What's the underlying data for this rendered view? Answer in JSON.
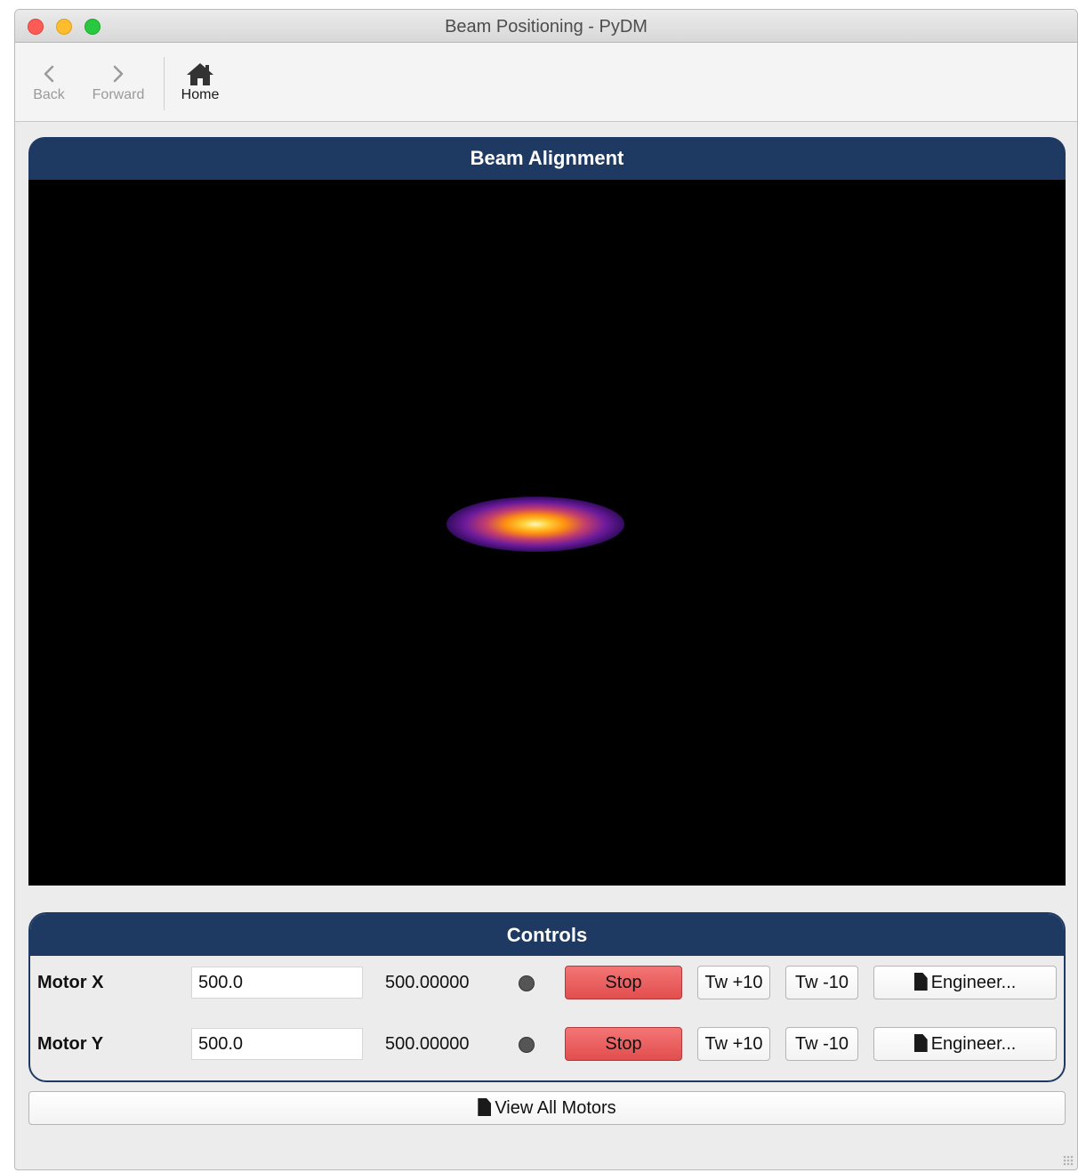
{
  "window": {
    "title": "Beam Positioning - PyDM"
  },
  "toolbar": {
    "back_label": "Back",
    "forward_label": "Forward",
    "home_label": "Home",
    "back_icon": "chevron-left-icon",
    "forward_icon": "chevron-right-icon",
    "home_icon": "house-icon"
  },
  "beam_panel": {
    "title": "Beam Alignment"
  },
  "controls": {
    "title": "Controls",
    "motors": [
      {
        "label": "Motor X",
        "setpoint": "500.0",
        "readback": "500.00000",
        "stop_label": "Stop",
        "tweak_plus_label": "Tw +10",
        "tweak_minus_label": "Tw -10",
        "engineer_label": "Engineer..."
      },
      {
        "label": "Motor Y",
        "setpoint": "500.0",
        "readback": "500.00000",
        "stop_label": "Stop",
        "tweak_plus_label": "Tw +10",
        "tweak_minus_label": "Tw -10",
        "engineer_label": "Engineer..."
      }
    ]
  },
  "view_all_label": "View All Motors",
  "colors": {
    "header_navy": "#1e3a63",
    "stop_red": "#e85b5b",
    "led_gray": "#555555",
    "image_background": "#000000"
  }
}
